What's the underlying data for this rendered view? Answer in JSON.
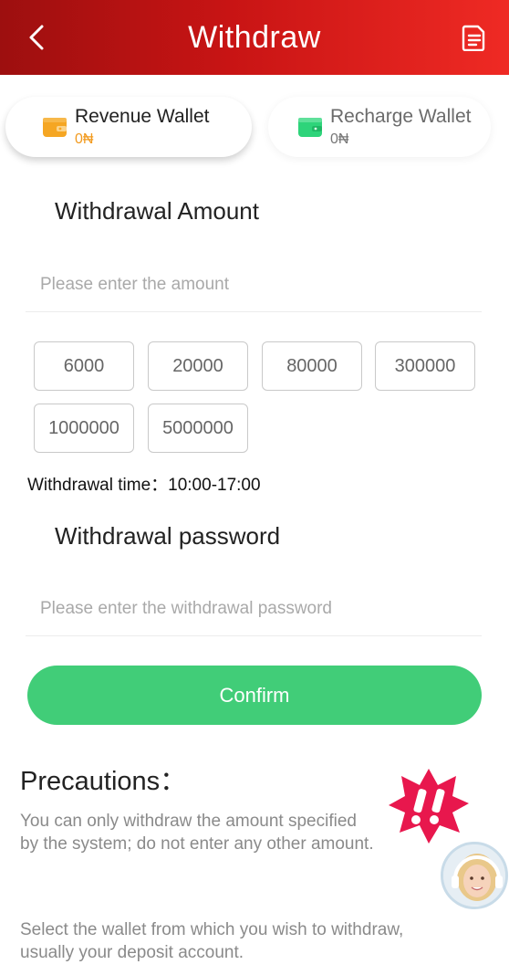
{
  "header": {
    "title": "Withdraw",
    "back_icon": "chevron-left-icon",
    "record_icon": "document-icon"
  },
  "wallets": [
    {
      "name": "Revenue Wallet",
      "balance": "0₦",
      "icon": "wallet-icon",
      "color": "#f5a623",
      "selected": true
    },
    {
      "name": "Recharge Wallet",
      "balance": "0₦",
      "icon": "wallet-icon",
      "color": "#2ed47a",
      "selected": false
    }
  ],
  "amount": {
    "title": "Withdrawal Amount",
    "placeholder": "Please enter the amount",
    "value": "",
    "options": [
      "6000",
      "20000",
      "80000",
      "300000",
      "1000000",
      "5000000"
    ]
  },
  "withdrawal_time": "Withdrawal time：10:00-17:00",
  "password": {
    "title": "Withdrawal password",
    "placeholder": "Please enter the withdrawal password",
    "value": ""
  },
  "confirm_label": "Confirm",
  "precautions": {
    "title": "Precautions：",
    "items": [
      "You can only withdraw the amount specified by the system; do not enter any other amount.",
      "Select the wallet from which you wish to withdraw, usually your deposit account."
    ]
  },
  "colors": {
    "header_start": "#9d0f0f",
    "header_end": "#ef2a24",
    "confirm": "#41cd78",
    "balance_active": "#f29a1e"
  }
}
